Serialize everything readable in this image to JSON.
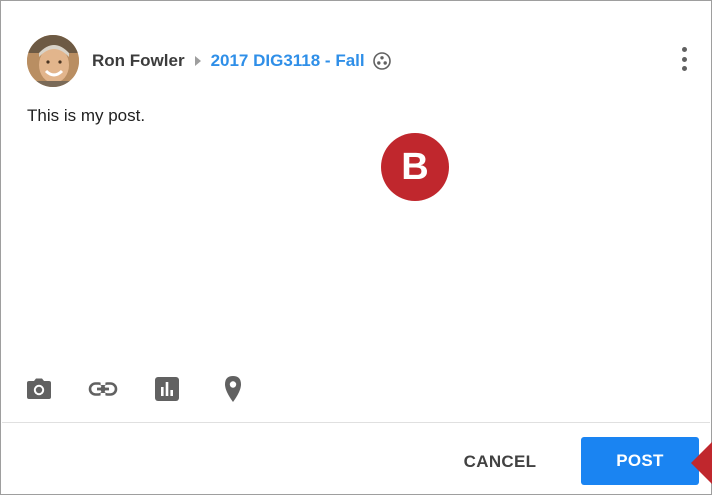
{
  "header": {
    "author": "Ron Fowler",
    "community": "2017 DIG3118 - Fall"
  },
  "post": {
    "text": "This is my post."
  },
  "callout": {
    "label": "B"
  },
  "toolbar": {
    "icons": [
      "camera-icon",
      "link-icon",
      "poll-icon",
      "location-icon"
    ]
  },
  "actions": {
    "cancel_label": "CANCEL",
    "post_label": "POST"
  },
  "colors": {
    "community_link": "#2f8fe8",
    "post_button": "#1a84f2",
    "callout": "#c0272d"
  }
}
